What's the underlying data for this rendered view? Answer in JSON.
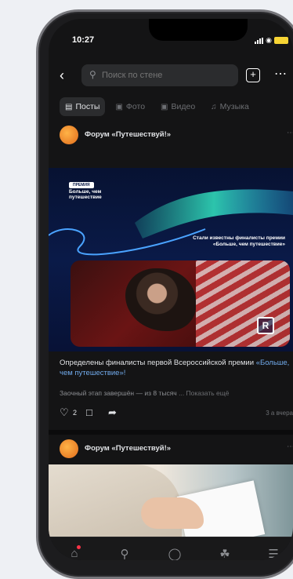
{
  "status_bar": {
    "time": "10:27"
  },
  "header": {
    "search_placeholder": "Поиск по стене"
  },
  "tabs": [
    {
      "label": "Посты",
      "icon": "posts-icon"
    },
    {
      "label": "Фото",
      "icon": "photo-icon"
    },
    {
      "label": "Видео",
      "icon": "video-icon"
    },
    {
      "label": "Музыка",
      "icon": "music-icon"
    }
  ],
  "posts": [
    {
      "author": "Форум «Путешествуй!»",
      "banner": {
        "badge": "ПРЕМИЯ",
        "tagline": "Больше, чем путешествие",
        "caption_line1": "Стали известны финалисты премии",
        "caption_line2": "«Больше, чем путешествие»",
        "logo_letter": "R"
      },
      "text_before_link": "Определены финалисты первой Всероссийской премии ",
      "link_text": "«Больше, чем путешествие»!",
      "subtext": "Заочный этап завершён — из 8 тысяч ",
      "show_more": "... Показать ещё",
      "likes": "2",
      "date": "3 а вчера"
    },
    {
      "author": "Форум «Путешествуй!»"
    }
  ],
  "bottom_nav": [
    "home-icon",
    "search-icon",
    "messages-icon",
    "clips-icon",
    "menu-icon"
  ]
}
